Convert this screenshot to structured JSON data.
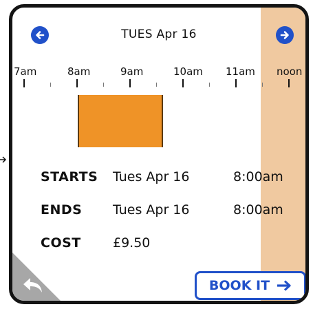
{
  "header": {
    "date_title": "TUES Apr 16",
    "prev_icon": "arrow-left-circle-icon",
    "next_icon": "arrow-right-circle-icon"
  },
  "timeline": {
    "labels": [
      "7am",
      "8am",
      "9am",
      "10am",
      "11am",
      "noon"
    ],
    "booking": {
      "start_hour": 8.0,
      "end_hour": 9.5
    },
    "unavailable_from_hour": 11.5
  },
  "details": {
    "starts_label": "STARTS",
    "starts_date": "Tues Apr 16",
    "starts_time": "8:00am",
    "ends_label": "ENDS",
    "ends_date": "Tues Apr 16",
    "ends_time": "8:00am",
    "cost_label": "COST",
    "cost_value": "£9.50"
  },
  "actions": {
    "book_label": "BOOK IT",
    "book_icon": "arrow-right-icon",
    "back_icon": "back-arrow-icon"
  },
  "colors": {
    "accent": "#2151c9",
    "booking": "#ef9327",
    "unavailable": "#f0c9a0",
    "corner": "#a7a7a7"
  }
}
